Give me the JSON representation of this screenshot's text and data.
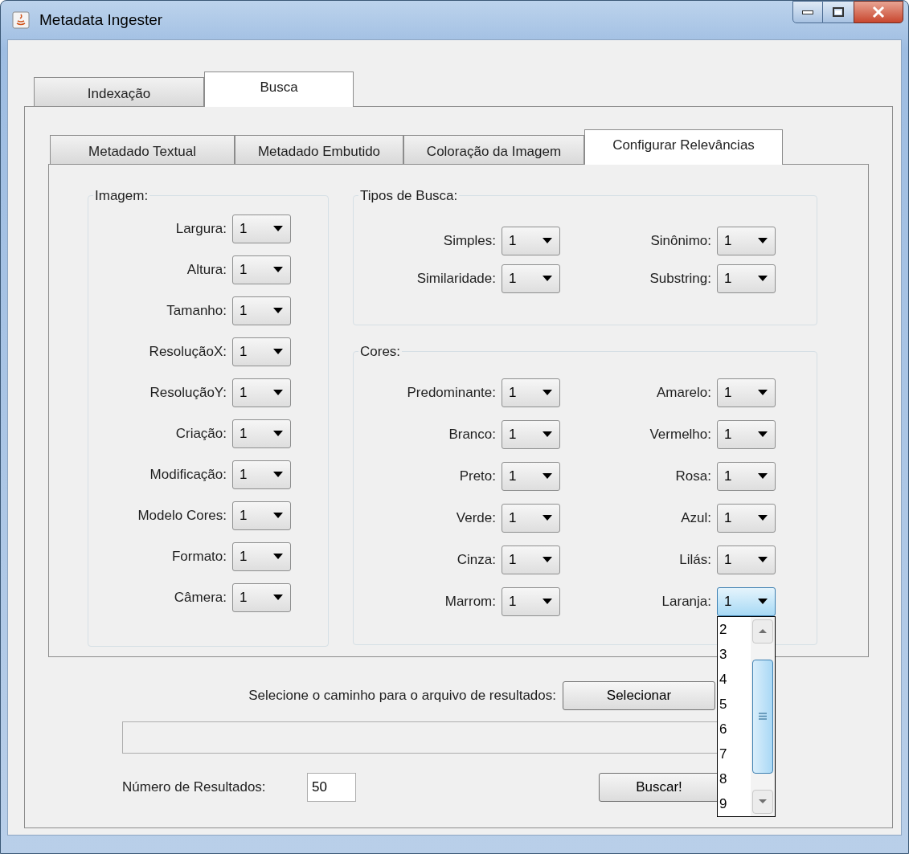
{
  "window": {
    "title": "Metadata Ingester"
  },
  "tabs": [
    {
      "label": "Indexação",
      "selected": false
    },
    {
      "label": "Busca",
      "selected": true
    }
  ],
  "subtabs": [
    {
      "label": "Metadado Textual",
      "selected": false
    },
    {
      "label": "Metadado Embutido",
      "selected": false
    },
    {
      "label": "Coloração da Imagem",
      "selected": false
    },
    {
      "label": "Configurar Relevâncias",
      "selected": true
    }
  ],
  "image_group": {
    "title": "Imagem:",
    "fields": [
      {
        "label": "Largura:",
        "value": "1",
        "open": false
      },
      {
        "label": "Altura:",
        "value": "1",
        "open": false
      },
      {
        "label": "Tamanho:",
        "value": "1",
        "open": false
      },
      {
        "label": "ResoluçãoX:",
        "value": "1",
        "open": false
      },
      {
        "label": "ResoluçãoY:",
        "value": "1",
        "open": false
      },
      {
        "label": "Criação:",
        "value": "1",
        "open": false
      },
      {
        "label": "Modificação:",
        "value": "1",
        "open": false
      },
      {
        "label": "Modelo Cores:",
        "value": "1",
        "open": false
      },
      {
        "label": "Formato:",
        "value": "1",
        "open": false
      },
      {
        "label": "Câmera:",
        "value": "1",
        "open": false
      }
    ]
  },
  "search_types": {
    "title": "Tipos de Busca:",
    "fields": [
      {
        "label": "Simples:",
        "value": "1",
        "open": false
      },
      {
        "label": "Sinônimo:",
        "value": "1",
        "open": false
      },
      {
        "label": "Similaridade:",
        "value": "1",
        "open": false
      },
      {
        "label": "Substring:",
        "value": "1",
        "open": false
      }
    ]
  },
  "colors": {
    "title": "Cores:",
    "fields": [
      {
        "label": "Predominante:",
        "value": "1",
        "open": false
      },
      {
        "label": "Amarelo:",
        "value": "1",
        "open": false
      },
      {
        "label": "Branco:",
        "value": "1",
        "open": false
      },
      {
        "label": "Vermelho:",
        "value": "1",
        "open": false
      },
      {
        "label": "Preto:",
        "value": "1",
        "open": false
      },
      {
        "label": "Rosa:",
        "value": "1",
        "open": false
      },
      {
        "label": "Verde:",
        "value": "1",
        "open": false
      },
      {
        "label": "Azul:",
        "value": "1",
        "open": false
      },
      {
        "label": "Cinza:",
        "value": "1",
        "open": false
      },
      {
        "label": "Lilás:",
        "value": "1",
        "open": false
      },
      {
        "label": "Marrom:",
        "value": "1",
        "open": false
      },
      {
        "label": "Laranja:",
        "value": "1",
        "open": true,
        "options": [
          "2",
          "3",
          "4",
          "5",
          "6",
          "7",
          "8",
          "9"
        ]
      }
    ]
  },
  "results_path": {
    "label": "Selecione o caminho para o arquivo de resultados:",
    "button": "Selecionar"
  },
  "results_count": {
    "label": "Número de Resultados:",
    "value": "50"
  },
  "search_button": "Buscar!"
}
